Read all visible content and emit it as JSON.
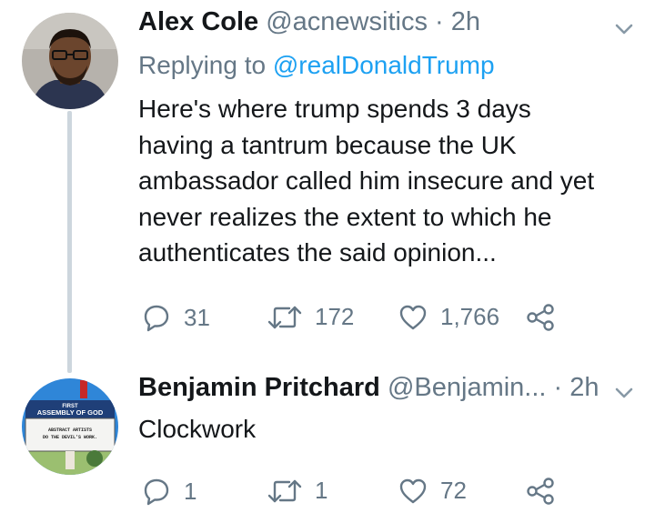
{
  "tweet1": {
    "name": "Alex Cole",
    "handle": "@acnewsitics",
    "separator": "·",
    "time": "2h",
    "replying_prefix": "Replying to ",
    "replying_to": "@realDonaldTrump",
    "lines": [
      "Here's where trump spends 3 days",
      "having a tantrum because the UK",
      "ambassador called him insecure and yet",
      "never realizes the extent to which he",
      "authenticates the said opinion..."
    ],
    "replies": "31",
    "retweets": "172",
    "likes": "1,766"
  },
  "tweet2": {
    "name": "Benjamin Pritchard",
    "handle": "@Benjamin...",
    "separator": "·",
    "time": "2h",
    "text": "Clockwork",
    "replies": "1",
    "retweets": "1",
    "likes": "72",
    "avatar_sign": {
      "title_line1": "FIRST",
      "title_line2": "ASSEMBLY OF GOD",
      "message_line1": "ABSTRACT ARTISTS",
      "message_line2": "DO THE DEVIL'S WORK."
    }
  },
  "colors": {
    "text": "#14171a",
    "secondary": "#657786",
    "link": "#1da1f2",
    "thread_line": "#cdd6dd"
  }
}
